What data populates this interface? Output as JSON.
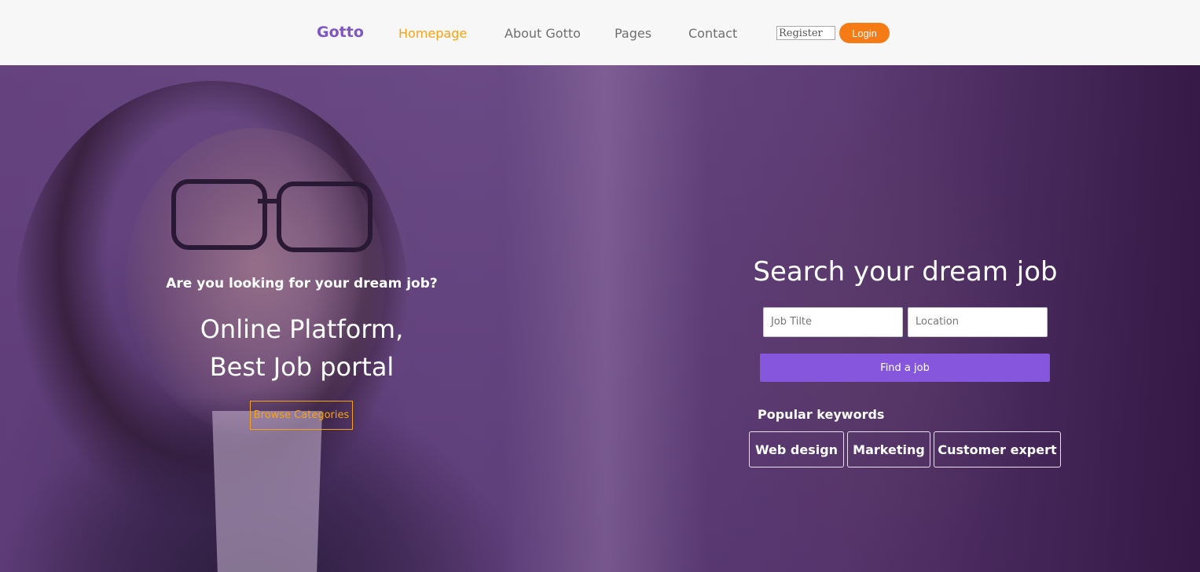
{
  "header": {
    "logo": "Gotto",
    "nav": [
      {
        "label": "Homepage",
        "active": true
      },
      {
        "label": "About Gotto",
        "active": false
      },
      {
        "label": "Pages",
        "active": false
      },
      {
        "label": "Contact",
        "active": false
      }
    ],
    "register_label": "Register",
    "login_label": "Login"
  },
  "hero": {
    "subtitle": "Are you looking for your dream job?",
    "headline_line1": "Online Platform,",
    "headline_line2": "Best Job portal",
    "browse_label": "Browse Categories"
  },
  "search": {
    "title": "Search your dream job",
    "job_title_placeholder": "Job Tilte",
    "location_placeholder": "Location",
    "find_label": "Find a job",
    "popular_label": "Popular keywords",
    "keywords": [
      "Web design",
      "Marketing",
      "Customer expert"
    ]
  },
  "colors": {
    "brand": "#7e57c2",
    "accent_orange": "#f6a21a",
    "login": "#f47b16",
    "find_button": "#8657dc"
  }
}
